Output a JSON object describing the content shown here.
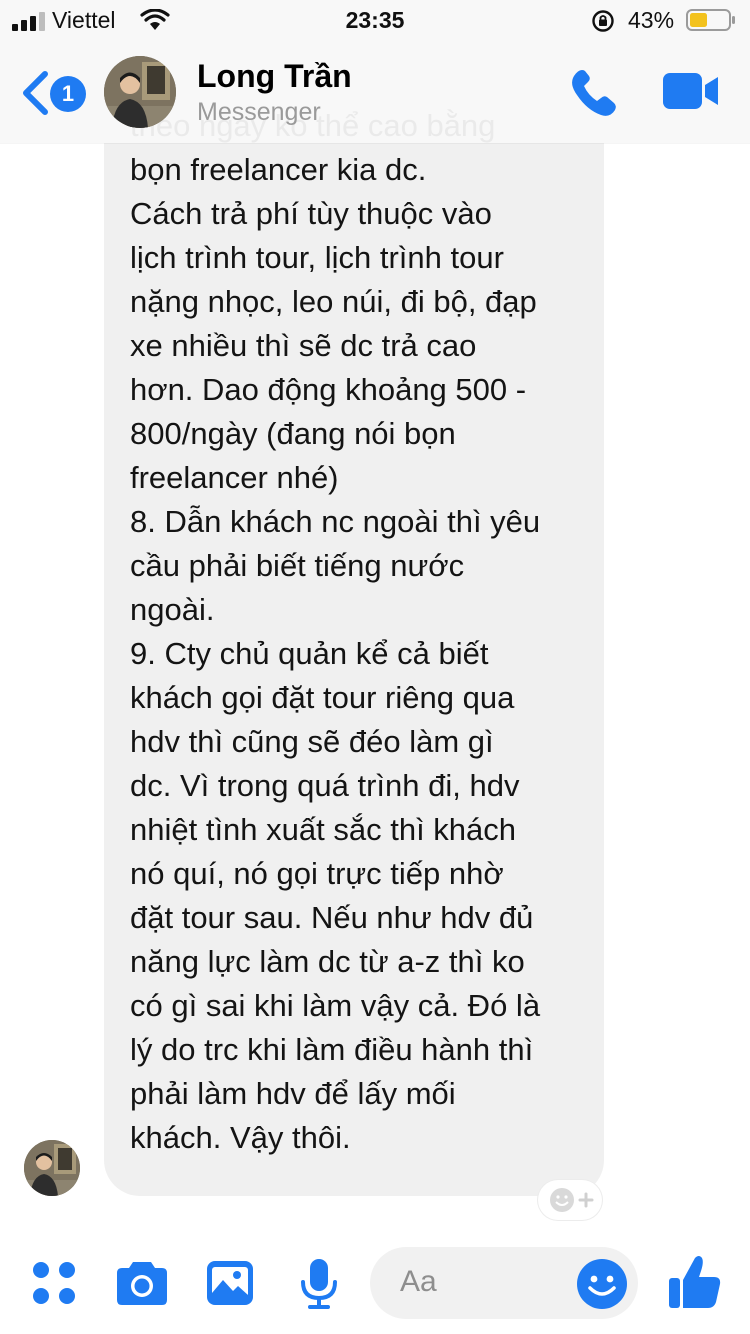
{
  "status_bar": {
    "carrier": "Viettel",
    "time": "23:35",
    "battery_percent": "43%",
    "battery_level": 0.43
  },
  "header": {
    "unread_count": "1",
    "contact_name": "Long Trần",
    "subtitle": "Messenger",
    "icons": [
      "back-chevron-icon",
      "phone-icon",
      "video-camera-icon"
    ]
  },
  "message": {
    "lines": [
      "theo ngày ko thể cao bằng",
      "bọn freelancer kia dc.",
      "Cách trả phí tùy thuộc vào",
      "lịch trình tour, lịch trình tour",
      "nặng nhọc, leo núi, đi bộ, đạp",
      "xe nhiều thì sẽ dc trả cao",
      "hơn. Dao động khoảng 500 -",
      "800/ngày (đang nói bọn",
      "freelancer nhé)",
      "8. Dẫn khách nc ngoài thì yêu",
      "cầu phải biết tiếng nước",
      "ngoài.",
      "9. Cty chủ quản kể cả biết",
      "khách gọi đặt tour riêng qua",
      "hdv thì cũng sẽ đéo làm gì",
      "dc. Vì trong quá trình đi, hdv",
      "nhiệt tình xuất sắc thì khách",
      "nó quí, nó gọi trực tiếp nhờ",
      "đặt tour sau. Nếu như hdv đủ",
      "năng lực làm dc từ a-z thì ko",
      "có gì sai khi làm vậy cả. Đó là",
      "lý do trc khi làm điều hành thì",
      "phải làm hdv để lấy mối",
      "khách. Vậy thôi."
    ]
  },
  "composer": {
    "placeholder": "Aa",
    "icons": [
      "apps-grid-icon",
      "camera-icon",
      "photo-icon",
      "microphone-icon",
      "emoji-icon",
      "thumbs-up-icon"
    ]
  },
  "colors": {
    "accent": "#1f7bf2",
    "bubble": "#f0f0f0",
    "text": "#141414"
  }
}
